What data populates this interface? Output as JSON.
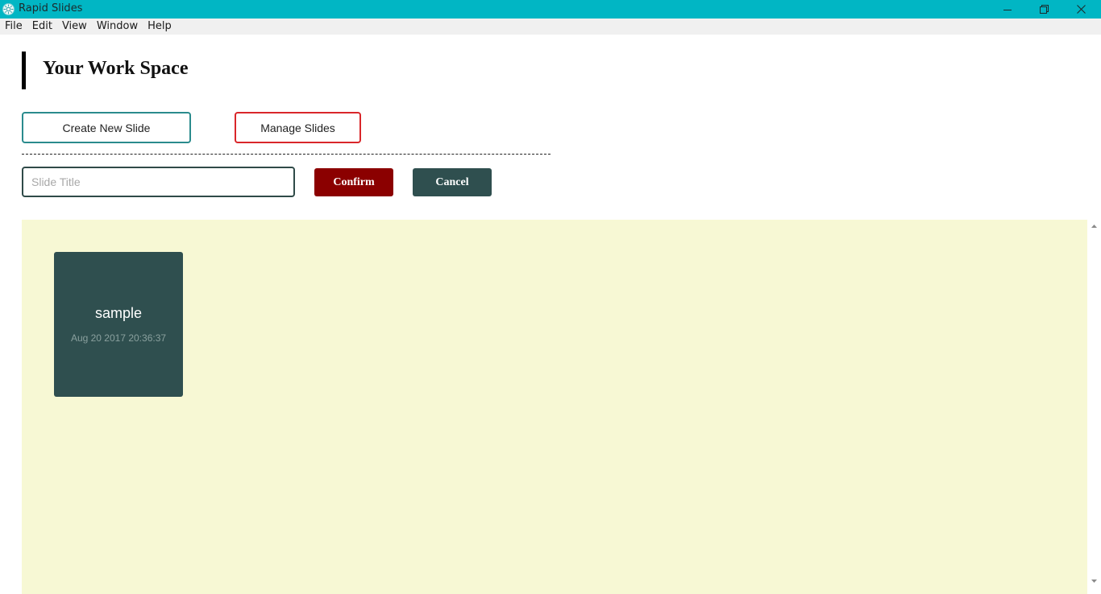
{
  "window": {
    "title": "Rapid Slides",
    "icon": "app-logo-icon",
    "controls": [
      "minimize-icon",
      "restore-icon",
      "close-icon"
    ]
  },
  "menu": {
    "items": [
      {
        "label": "File"
      },
      {
        "label": "Edit"
      },
      {
        "label": "View"
      },
      {
        "label": "Window"
      },
      {
        "label": "Help"
      }
    ]
  },
  "header": {
    "title": "Your Work Space"
  },
  "actions": {
    "create_label": "Create New Slide",
    "manage_label": "Manage Slides"
  },
  "new_slide_form": {
    "input_placeholder": "Slide Title",
    "input_value": "",
    "confirm_label": "Confirm",
    "cancel_label": "Cancel"
  },
  "slides": [
    {
      "name": "sample",
      "date": "Aug 20 2017 20:36:37"
    }
  ],
  "colors": {
    "titlebar": "#01b6c4",
    "create_border": "#2a8b8d",
    "manage_border": "#d9262a",
    "confirm_bg": "#8b0000",
    "cancel_bg": "#2f4f4f",
    "workspace_bg": "#f7f8d4",
    "card_bg": "#2f4f4f"
  }
}
